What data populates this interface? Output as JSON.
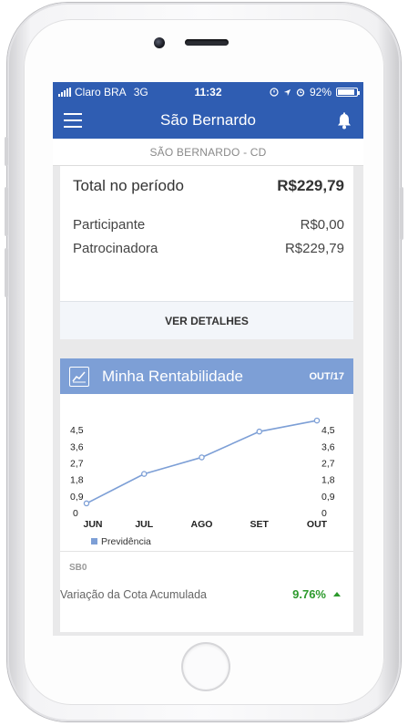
{
  "status_bar": {
    "carrier": "Claro BRA",
    "network": "3G",
    "time": "11:32",
    "battery_percent": "92%",
    "battery_level": 0.92
  },
  "nav": {
    "title": "São Bernardo",
    "icons": [
      "menu-icon",
      "bell-icon"
    ]
  },
  "plan": {
    "subtitle": "SÃO BERNARDO - CD"
  },
  "contributions": {
    "total_label": "Total no período",
    "total_value": "R$229,79",
    "rows": [
      {
        "label": "Participante",
        "value": "R$0,00"
      },
      {
        "label": "Patrocinadora",
        "value": "R$229,79"
      }
    ],
    "details_button": "VER DETALHES"
  },
  "rentabilidade": {
    "title": "Minha Rentabilidade",
    "month": "OUT/17",
    "fund_code": "SB0",
    "variation_label": "Variação da Cota Acumulada",
    "variation_value": "9.76%",
    "accent_color": "#7d9fd6",
    "positive_color": "#2c9a2c"
  },
  "chart_data": {
    "type": "line",
    "categories": [
      "JUN",
      "JUL",
      "AGO",
      "SET",
      "OUT"
    ],
    "series": [
      {
        "name": "Previdência",
        "values": [
          0.5,
          2.1,
          3.0,
          4.4,
          5.0
        ]
      }
    ],
    "y_ticks": [
      "0",
      "0,9",
      "1,8",
      "2,7",
      "3,6",
      "4,5"
    ],
    "ylim": [
      0,
      5.4
    ],
    "legend": "bottom-left",
    "color": "#7d9fd6"
  }
}
